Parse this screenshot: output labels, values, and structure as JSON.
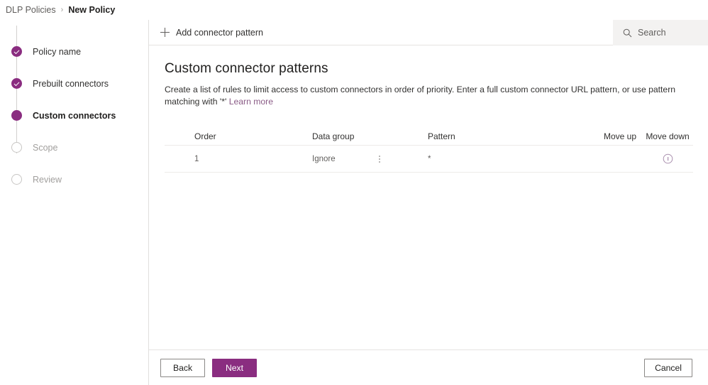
{
  "breadcrumb": {
    "parent": "DLP Policies",
    "separator": "›",
    "current": "New Policy"
  },
  "wizard": {
    "steps": [
      {
        "label": "Policy name",
        "state": "done"
      },
      {
        "label": "Prebuilt connectors",
        "state": "done"
      },
      {
        "label": "Custom connectors",
        "state": "active"
      },
      {
        "label": "Scope",
        "state": "todo"
      },
      {
        "label": "Review",
        "state": "todo"
      }
    ]
  },
  "commandbar": {
    "add_pattern_label": "Add connector pattern",
    "add_icon": "plus-icon"
  },
  "search": {
    "icon": "search-icon",
    "placeholder": "Search",
    "value": ""
  },
  "main": {
    "title": "Custom connector patterns",
    "description": "Create a list of rules to limit access to custom connectors in order of priority. Enter a full custom connector URL pattern, or use pattern matching with '*' ",
    "learn_more": "Learn more"
  },
  "table": {
    "columns": [
      "Order",
      "Data group",
      "Pattern",
      "Move up",
      "Move down"
    ],
    "rows": [
      {
        "order": "1",
        "data_group": "Ignore",
        "group_menu_icon": "kebab-menu-icon",
        "pattern": "*",
        "move_up": "",
        "move_down_icon": "info-icon"
      }
    ]
  },
  "footer": {
    "back_label": "Back",
    "next_label": "Next",
    "cancel_label": "Cancel"
  },
  "colors": {
    "accent": "#8a2d80",
    "link": "#8a5b86",
    "border": "#e1dfdd",
    "search_bg": "#f3f2f1"
  }
}
